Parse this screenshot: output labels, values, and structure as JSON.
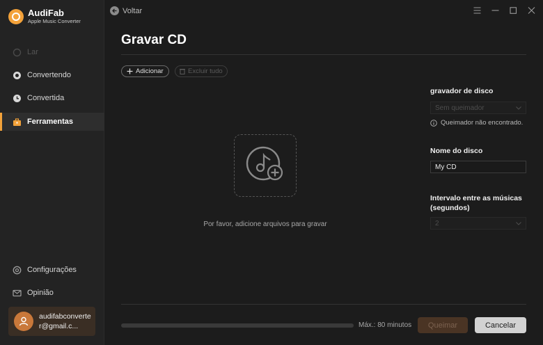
{
  "app": {
    "name": "AudiFab",
    "subtitle": "Apple Music Converter"
  },
  "sidebar": {
    "items": [
      {
        "label": "Lar",
        "icon": "home-icon",
        "state": "disabled"
      },
      {
        "label": "Convertendo",
        "icon": "convert-icon",
        "state": "normal"
      },
      {
        "label": "Convertida",
        "icon": "clock-icon",
        "state": "normal"
      },
      {
        "label": "Ferramentas",
        "icon": "toolbox-icon",
        "state": "active"
      }
    ],
    "bottom_items": [
      {
        "label": "Configurações",
        "icon": "gear-icon"
      },
      {
        "label": "Opinião",
        "icon": "mail-icon"
      }
    ],
    "user_email": "audifabconverter@gmail.c..."
  },
  "topbar": {
    "back_label": "Voltar"
  },
  "page": {
    "title": "Gravar CD",
    "add_label": "Adicionar",
    "delete_all_label": "Excluir tudo",
    "drop_hint": "Por favor, adicione arquivos para gravar"
  },
  "settings": {
    "burner_label": "gravador de disco",
    "burner_value": "Sem queimador",
    "burner_warning": "Queimador não encontrado.",
    "disc_name_label": "Nome do disco",
    "disc_name_value": "My CD",
    "gap_label": "Intervalo entre as músicas (segundos)",
    "gap_value": "2"
  },
  "footer": {
    "progress": 0,
    "max_label": "Máx.: 80 minutos",
    "burn_label": "Queimar",
    "cancel_label": "Cancelar"
  },
  "colors": {
    "accent": "#f3a23a",
    "background": "#1c1c1c",
    "sidebar": "#232323"
  }
}
